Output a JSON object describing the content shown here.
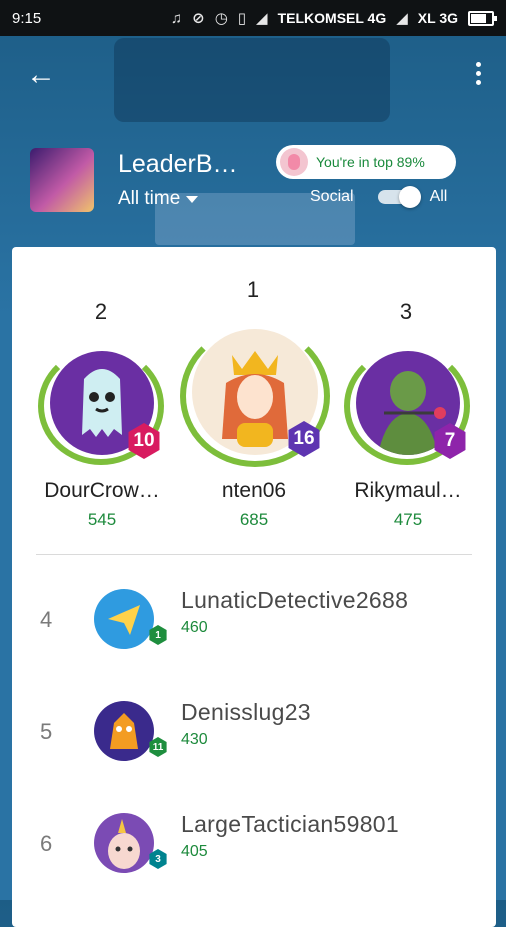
{
  "status_bar": {
    "time": "9:15",
    "carrier1": "TELKOMSEL 4G",
    "carrier2": "XL 3G",
    "icons": [
      "headphones-icon",
      "no-sync-icon",
      "alarm-icon",
      "vibrate-icon",
      "signal-icon",
      "battery-icon"
    ]
  },
  "header": {
    "title": "LeaderB…",
    "time_filter": "All time",
    "rank_pill_text": "You're in top 89%",
    "toggle_left": "Social",
    "toggle_right": "All",
    "toggle_on": true
  },
  "podium": [
    {
      "rank": "2",
      "name": "DourCrow…",
      "score": "545",
      "level": "10",
      "badge_color": "#d81b60",
      "avatar": "ghost-avatar"
    },
    {
      "rank": "1",
      "name": "nten06",
      "score": "685",
      "level": "16",
      "badge_color": "#5e35b1",
      "avatar": "queen-avatar"
    },
    {
      "rank": "3",
      "name": "Rikymaul…",
      "score": "475",
      "level": "7",
      "badge_color": "#8e24aa",
      "avatar": "soldier-avatar"
    }
  ],
  "list": [
    {
      "rank": "4",
      "name": "LunaticDetective2688",
      "score": "460",
      "level": "1",
      "badge_color": "#1e8e3e",
      "avatar": "paper-plane-avatar"
    },
    {
      "rank": "5",
      "name": "Denisslug23",
      "score": "430",
      "level": "11",
      "badge_color": "#1e8e3e",
      "avatar": "dragon-avatar"
    },
    {
      "rank": "6",
      "name": "LargeTactician59801",
      "score": "405",
      "level": "3",
      "badge_color": "#00838f",
      "avatar": "unicorn-avatar"
    }
  ],
  "colors": {
    "accent_green": "#1d8a3c",
    "header_blue": "#2a73a4"
  }
}
